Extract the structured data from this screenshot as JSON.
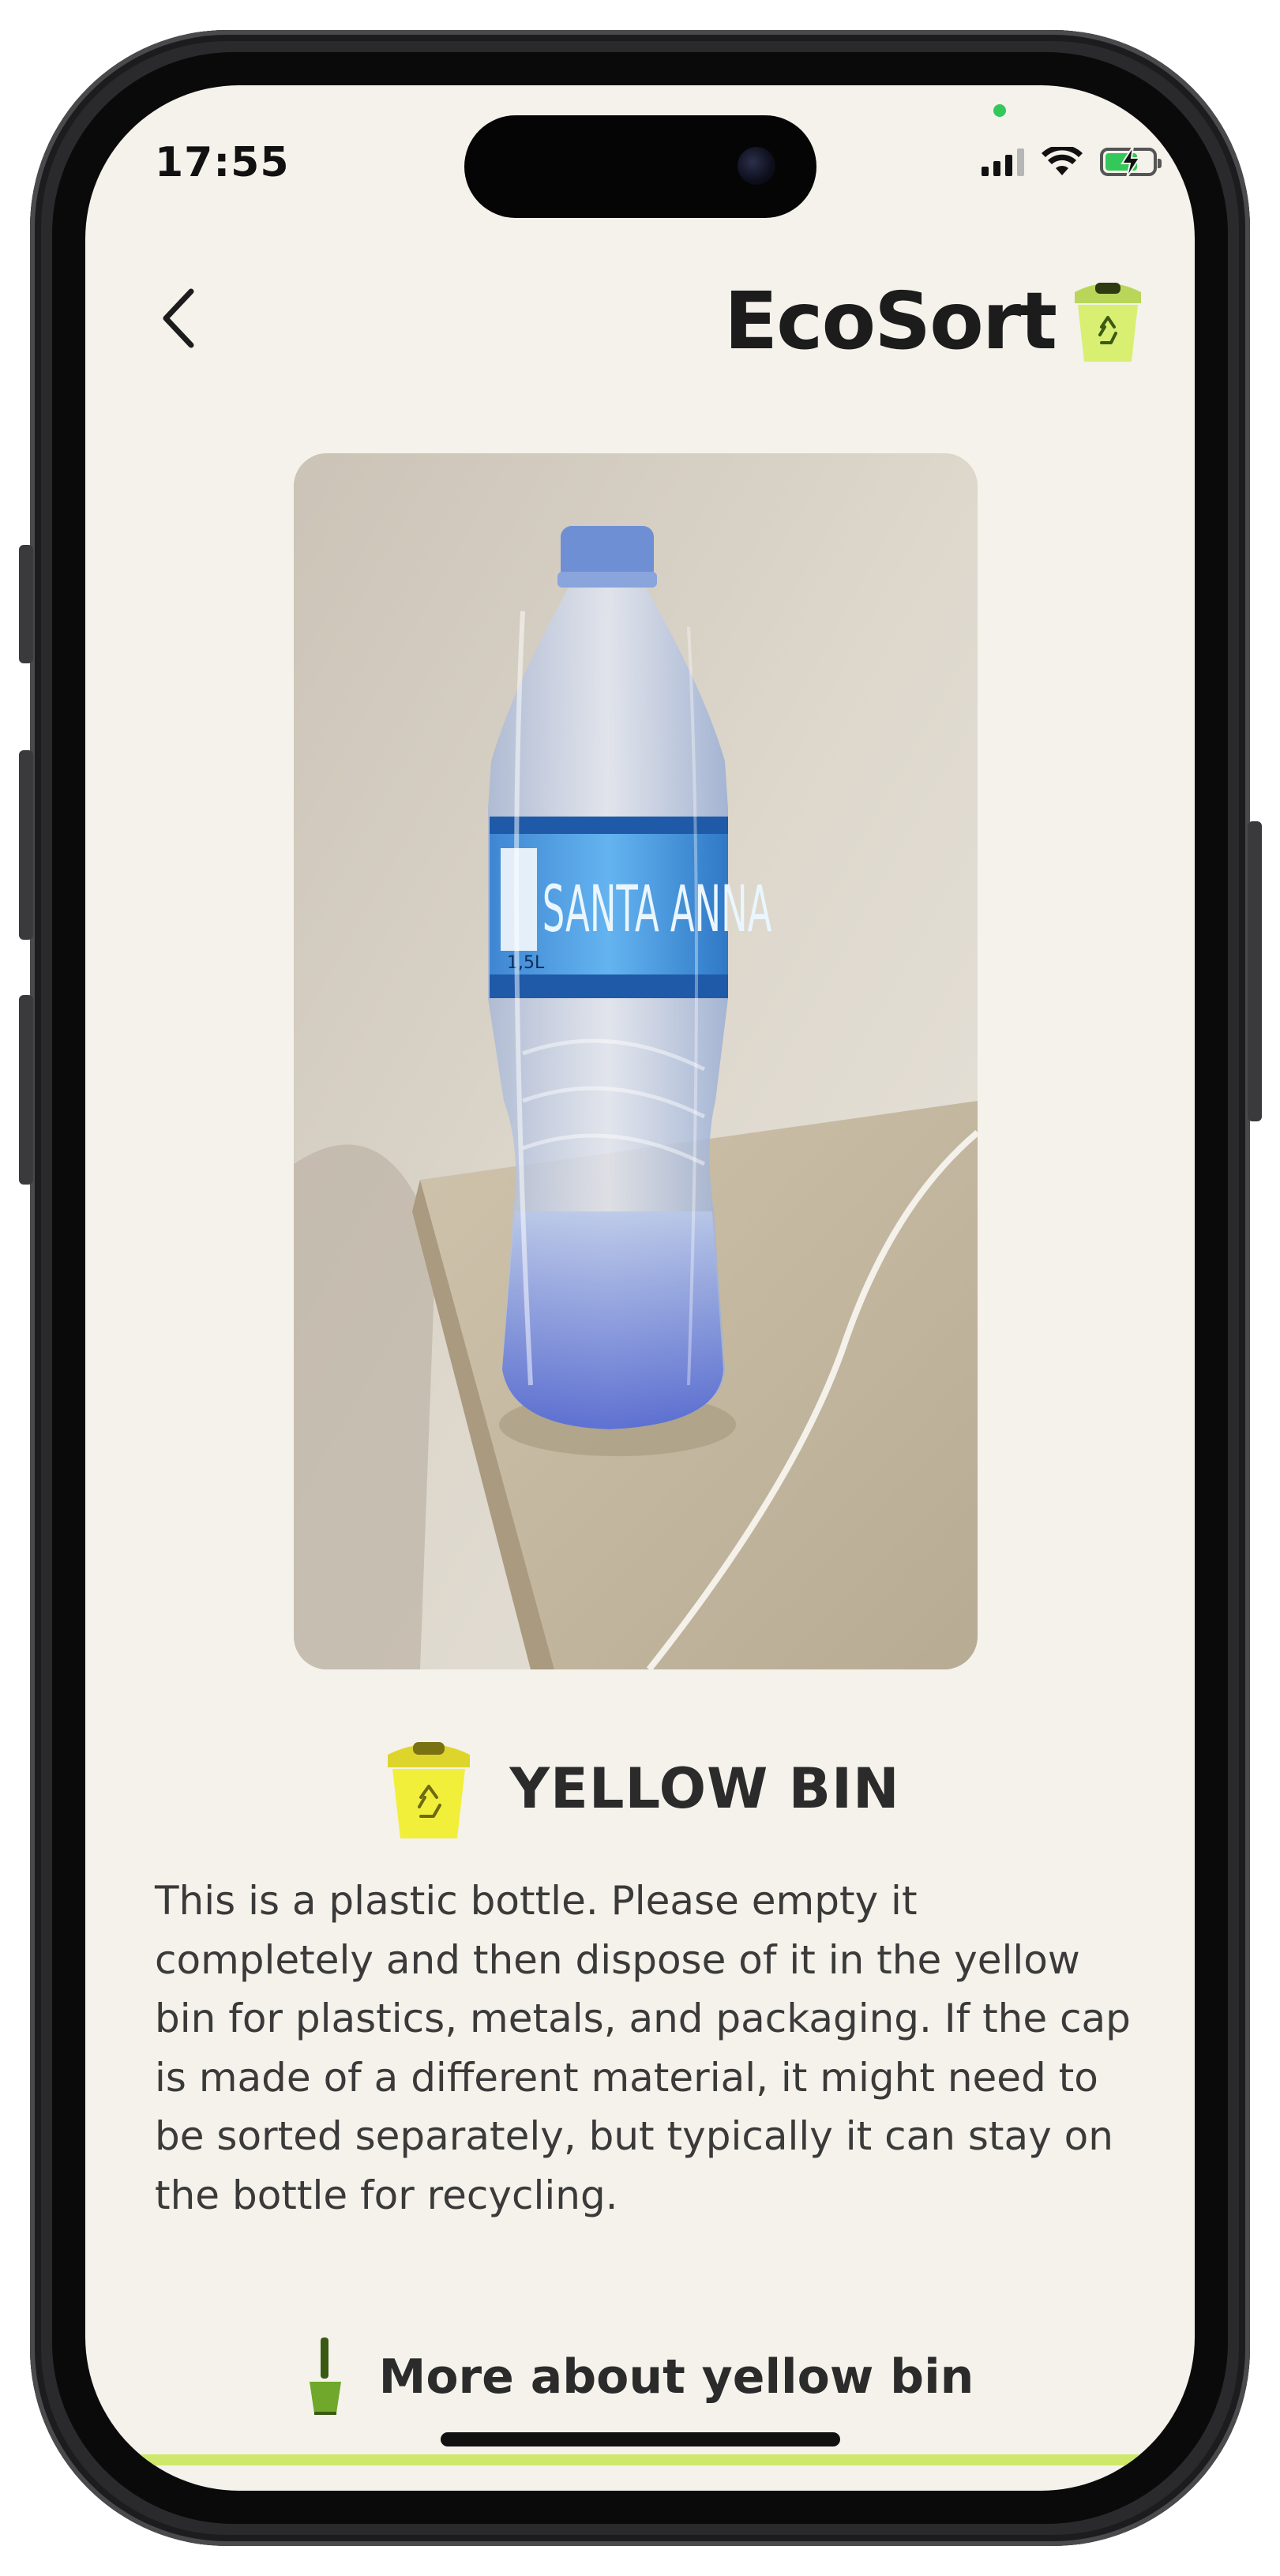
{
  "status_bar": {
    "time": "17:55"
  },
  "header": {
    "back_icon": "chevron-left-icon",
    "brand_name": "EcoSort",
    "brand_icon": "recycle-bin-icon"
  },
  "photo": {
    "subject": "plastic water bottle",
    "label_text": "SANTA ANNA",
    "size_text": "1,5L"
  },
  "result": {
    "bin_icon": "yellow-bin-icon",
    "bin_title": "YELLOW BIN",
    "description": "This is a plastic bottle. Please empty it completely and then dispose of it in the yellow bin for plastics, metals, and packaging. If the cap is made of a different material, it might need to be sorted separately, but typically it can stay on the bottle for recycling."
  },
  "more_link": {
    "label": "More about yellow bin",
    "icon": "light-bulb-icon"
  },
  "colors": {
    "background": "#f4f2ea",
    "brand_bin": "#cde86a",
    "yellow_bin": "#f2ef3a",
    "text": "#2b2b2b"
  }
}
